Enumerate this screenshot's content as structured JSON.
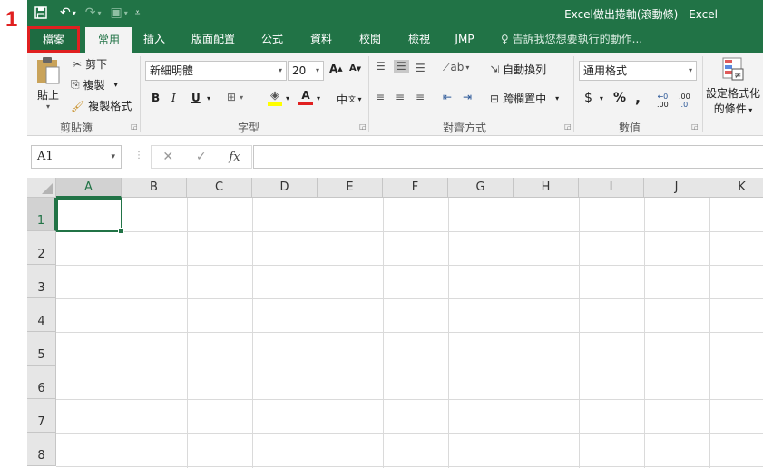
{
  "step_marker": "1",
  "window": {
    "title": "Excel做出捲軸(滾動條) - Excel"
  },
  "qat": {
    "save_icon": "save-icon",
    "undo_icon": "undo-icon",
    "redo_icon": "redo-icon",
    "touch_icon": "touch-mode-icon",
    "customize_icon": "customize-icon"
  },
  "tabs": [
    "檔案",
    "常用",
    "插入",
    "版面配置",
    "公式",
    "資料",
    "校閱",
    "檢視",
    "JMP"
  ],
  "active_tab": "常用",
  "tell_me": "告訴我您想要執行的動作...",
  "ribbon": {
    "clipboard": {
      "label": "剪貼簿",
      "paste": "貼上",
      "cut": "剪下",
      "copy": "複製",
      "format_painter": "複製格式"
    },
    "font": {
      "label": "字型",
      "font_name": "新細明體",
      "font_size": "20",
      "bold": "B",
      "italic": "I",
      "underline": "U",
      "grow": "A",
      "shrink": "A",
      "font_color_letter": "A",
      "phonetic": "中"
    },
    "alignment": {
      "label": "對齊方式",
      "wrap_text": "自動換列",
      "merge_center": "跨欄置中"
    },
    "number": {
      "label": "數值",
      "format": "通用格式",
      "currency": "$",
      "percent": "%",
      "comma": ",",
      "inc_decimal": ".00",
      "dec_decimal": ".0"
    },
    "styles": {
      "conditional_formatting_line1": "設定格式化",
      "conditional_formatting_line2": "的條件"
    }
  },
  "formula_bar": {
    "name_box": "A1",
    "fx": "fx",
    "value": ""
  },
  "columns": [
    "A",
    "B",
    "C",
    "D",
    "E",
    "F",
    "G",
    "H",
    "I",
    "J",
    "K"
  ],
  "rows": [
    "1",
    "2",
    "3",
    "4",
    "5",
    "6",
    "7",
    "8"
  ],
  "selected_cell": "A1",
  "colors": {
    "excel_green": "#217346",
    "highlight_red": "#e02020"
  }
}
